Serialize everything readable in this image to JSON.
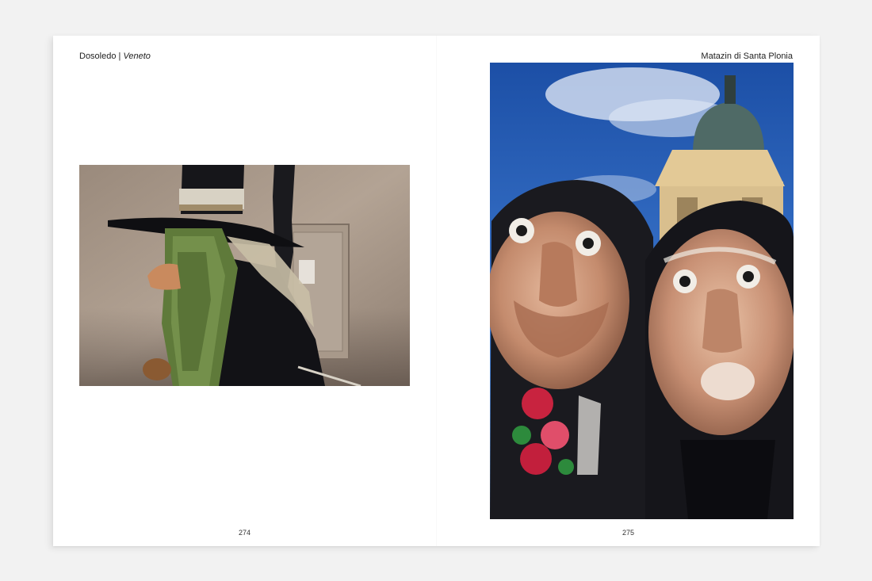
{
  "left_page": {
    "running_head_place": "Dosoledo",
    "running_head_separator": "|",
    "running_head_region": "Veneto",
    "page_number": "274"
  },
  "right_page": {
    "running_head_title": "Matazin di Santa Plonia",
    "page_number": "275"
  }
}
